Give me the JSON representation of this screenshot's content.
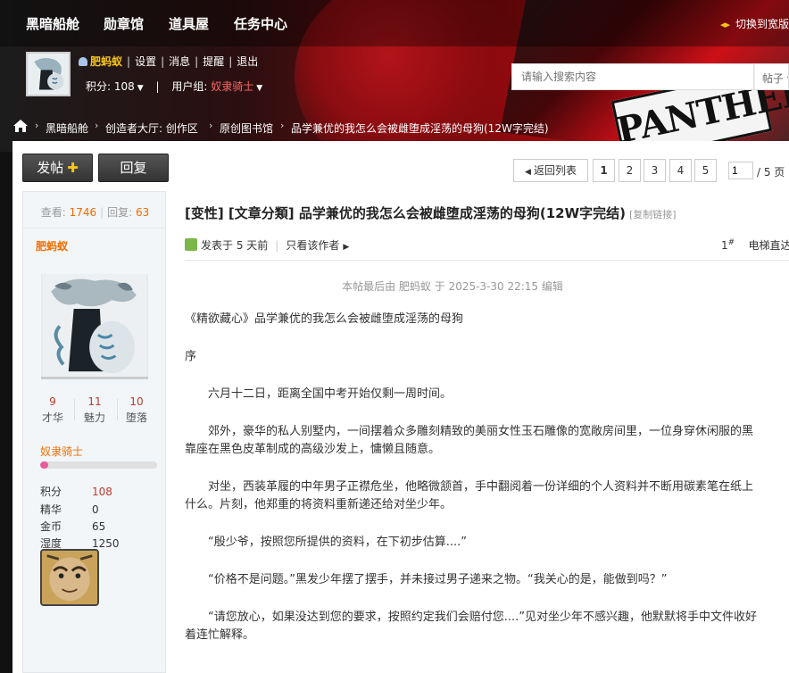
{
  "nav": {
    "items": [
      "黑暗船舱",
      "勋章馆",
      "道具屋",
      "任务中心"
    ],
    "switch_wide": "切换到宽版"
  },
  "user": {
    "name": "肥蚂蚁",
    "links": [
      "设置",
      "消息",
      "提醒",
      "退出"
    ],
    "points_label": "积分: 108",
    "group_label": "用户组:",
    "group": "奴隶骑士"
  },
  "search": {
    "placeholder": "请输入搜索内容",
    "type": "帖子"
  },
  "breadcrumb": [
    "黑暗船舱",
    "创造者大厅: 创作区",
    "原创图书馆",
    "品学兼优的我怎么会被雌堕成淫荡的母狗(12W字完结)"
  ],
  "banner_text": "PANTHER",
  "actions": {
    "post": "发帖",
    "reply": "回复"
  },
  "pager": {
    "back": "返回列表",
    "pages": [
      "1",
      "2",
      "3",
      "4",
      "5"
    ],
    "current": "1",
    "total": "/ 5 页"
  },
  "author": {
    "views_label": "查看:",
    "views": "1746",
    "replies_label": "回复:",
    "replies": "63",
    "name": "肥蚂蚁",
    "stats": [
      {
        "value": "9",
        "label": "才华"
      },
      {
        "value": "11",
        "label": "魅力"
      },
      {
        "value": "10",
        "label": "堕落"
      }
    ],
    "group": "奴隶骑士",
    "level_progress": 0.07,
    "fields": [
      {
        "key": "积分",
        "value": "108"
      },
      {
        "key": "精华",
        "value": "0"
      },
      {
        "key": "金币",
        "value": "65"
      },
      {
        "key": "湿度",
        "value": "1250"
      }
    ]
  },
  "post": {
    "title": "[变性] [文章分類] 品学兼优的我怎么会被雌堕成淫荡的母狗(12W字完结)",
    "copy_link": "[复制链接]",
    "posted": "发表于 5 天前",
    "only_author": "只看该作者",
    "floor_num": "1",
    "floor_sup": "#",
    "floor_text": "电梯直达",
    "edit_note": "本帖最后由 肥蚂蚁 于 2025-3-30 22:15 编辑",
    "paragraphs": [
      "《精欲藏心》品学兼优的我怎么会被雌堕成淫荡的母狗",
      "序",
      "六月十二日，距离全国中考开始仅剩一周时间。",
      "郊外，豪华的私人别墅内，一间摆着众多雕刻精致的美丽女性玉石雕像的宽敞房间里，一位身穿休闲服的黑",
      "靠座在黑色皮革制成的高级沙发上，慵懒且随意。",
      "对坐，西装革履的中年男子正襟危坐，他略微颔首，手中翻阅着一份详细的个人资料并不断用碳素笔在纸上",
      "什么。片刻，他郑重的将资料重新递还给对坐少年。",
      "“殷少爷，按照您所提供的资料，在下初步估算....”",
      "“价格不是问题。”黑发少年摆了摆手，并未接过男子递来之物。“我关心的是，能做到吗？”",
      "“请您放心，如果没达到您的要求，按照约定我们会赔付您....”见对坐少年不感兴趣，他默默将手中文件收好",
      "着连忙解释。"
    ]
  },
  "colors": {
    "accent_orange": "#f26c00",
    "group_red": "#ff6666",
    "nav_bg": "#b3090f",
    "stat_red": "#c0392b"
  }
}
